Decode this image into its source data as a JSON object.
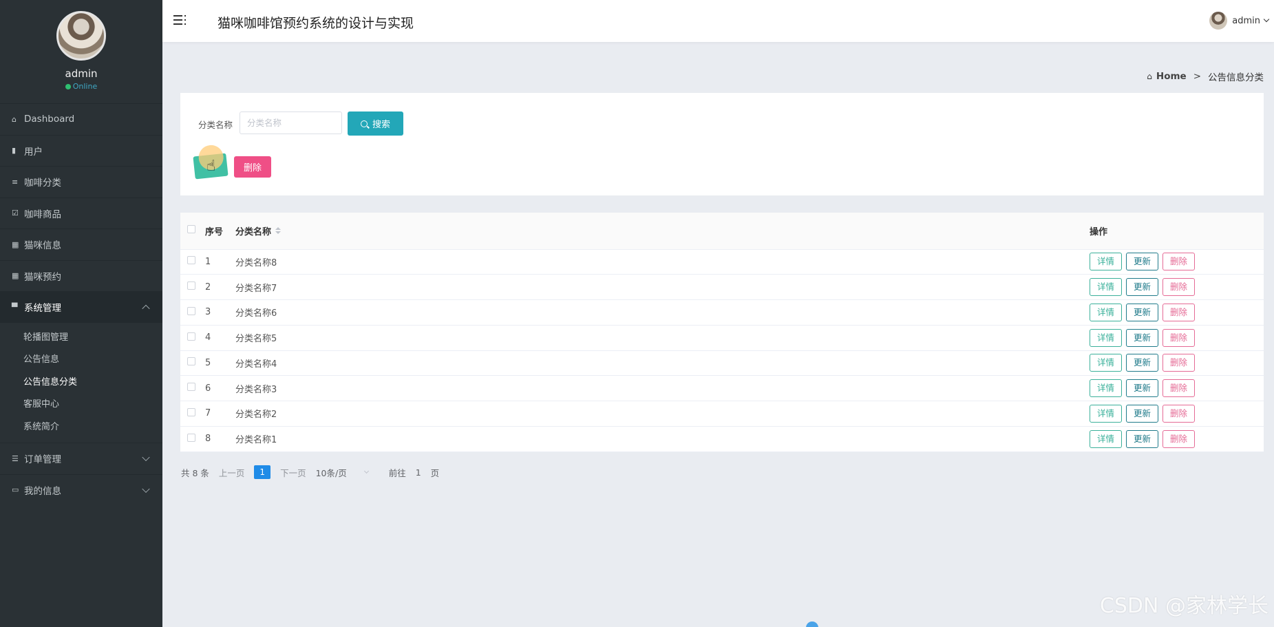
{
  "sidebar": {
    "profile_name": "admin",
    "status": "Online",
    "items": [
      {
        "label": "Dashboard",
        "icon": "home-icon"
      },
      {
        "label": "用户",
        "icon": "bar-chart-icon"
      },
      {
        "label": "咖啡分类",
        "icon": "sliders-icon"
      },
      {
        "label": "咖啡商品",
        "icon": "check-square-icon"
      },
      {
        "label": "猫咪信息",
        "icon": "grid-icon"
      },
      {
        "label": "猫咪预约",
        "icon": "grid-icon"
      },
      {
        "label": "系统管理",
        "icon": "monitor-icon"
      },
      {
        "label": "订单管理",
        "icon": "list-icon"
      },
      {
        "label": "我的信息",
        "icon": "card-icon"
      }
    ],
    "submenu": [
      "轮播图管理",
      "公告信息",
      "公告信息分类",
      "客服中心",
      "系统简介"
    ]
  },
  "header": {
    "title": "猫咪咖啡馆预约系统的设计与实现",
    "user": "admin"
  },
  "breadcrumb": {
    "home": "Home",
    "separator": ">",
    "current": "公告信息分类"
  },
  "search": {
    "label": "分类名称",
    "placeholder": "分类名称",
    "button": "搜索"
  },
  "actions": {
    "delete": "删除"
  },
  "table": {
    "headers": {
      "index": "序号",
      "name": "分类名称",
      "ops": "操作"
    },
    "rows": [
      {
        "index": "1",
        "name": "分类名称8"
      },
      {
        "index": "2",
        "name": "分类名称7"
      },
      {
        "index": "3",
        "name": "分类名称6"
      },
      {
        "index": "4",
        "name": "分类名称5"
      },
      {
        "index": "5",
        "name": "分类名称4"
      },
      {
        "index": "6",
        "name": "分类名称3"
      },
      {
        "index": "7",
        "name": "分类名称2"
      },
      {
        "index": "8",
        "name": "分类名称1"
      }
    ],
    "ops": {
      "detail": "详情",
      "update": "更新",
      "remove": "删除"
    }
  },
  "pagination": {
    "total": "共 8 条",
    "prev": "上一页",
    "current": "1",
    "next": "下一页",
    "page_size": "10条/页",
    "goto_label": "前往",
    "goto_value": "1",
    "goto_suffix": "页"
  },
  "watermark": "CSDN @家林学长",
  "colors": {
    "sidebar_bg": "#2a3135",
    "primary": "#23a7b8",
    "danger": "#ef4f86",
    "page_active": "#1f8be7"
  }
}
